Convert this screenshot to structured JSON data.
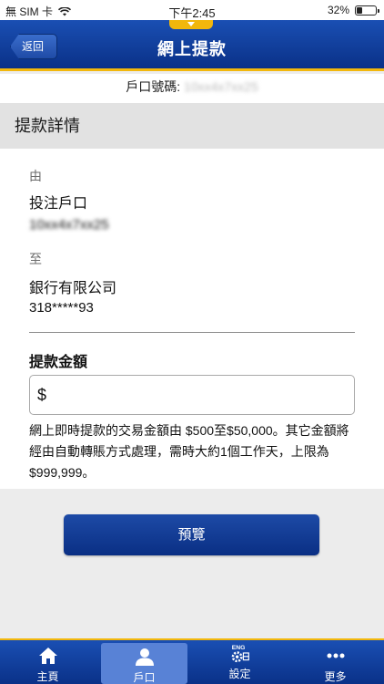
{
  "status_bar": {
    "carrier": "無 SIM 卡",
    "time": "下午2:45",
    "battery": "32%",
    "battery_level": 0.32
  },
  "header": {
    "back_label": "返回",
    "title": "網上提款"
  },
  "account": {
    "label": "戶口號碼:",
    "number": "10xx4x7xx25"
  },
  "section": {
    "title": "提款詳情"
  },
  "details": {
    "from_label": "由",
    "from_name": "投注戶口",
    "from_number": "10xx4x7xx25",
    "to_label": "至",
    "to_name": "銀行有限公司",
    "to_number": "318*****93",
    "amount_label": "提款金額",
    "currency_symbol": "$",
    "amount_value": "",
    "note": "網上即時提款的交易金額由 $500至$50,000。其它金額將經由自動轉賬方式處理，需時大約1個工作天，上限為$999,999。"
  },
  "preview_button": "預覽",
  "tabs": [
    {
      "label": "主頁",
      "icon": "home-icon"
    },
    {
      "label": "戶口",
      "icon": "user-icon"
    },
    {
      "label": "設定",
      "icon": "settings-gear-icon",
      "icon_text": "ENG"
    },
    {
      "label": "更多",
      "icon": "more-dots-icon"
    }
  ]
}
